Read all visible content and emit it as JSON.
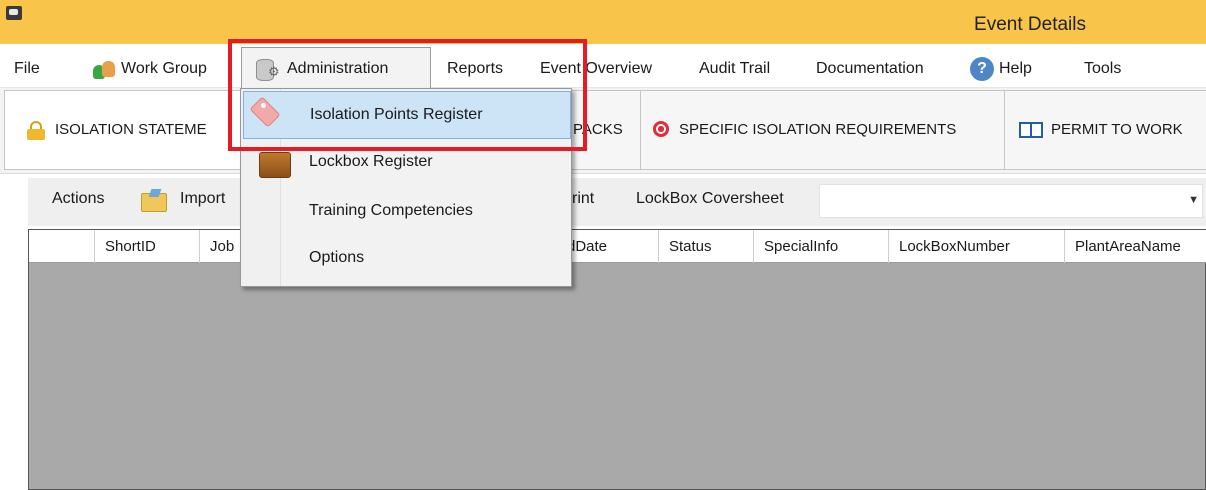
{
  "window": {
    "title": "Event Details"
  },
  "menu": {
    "file": "File",
    "work_group": "Work Group",
    "administration": "Administration",
    "reports": "Reports",
    "event_overview": "Event Overview",
    "audit_trail": "Audit Trail",
    "documentation": "Documentation",
    "help": "Help",
    "tools": "Tools"
  },
  "tabs": {
    "isolation": "ISOLATION STATEME",
    "packs": "PACKS",
    "specific": "SPECIFIC ISOLATION REQUIREMENTS",
    "permit": "PERMIT TO WORK"
  },
  "toolbar": {
    "actions": "Actions",
    "import": "Import",
    "print": "rint",
    "lockbox_coversheet": "LockBox Coversheet",
    "coversheet_value": ""
  },
  "grid": {
    "columns": [
      "ShortID",
      "Job",
      "dDate",
      "Status",
      "SpecialInfo",
      "LockBoxNumber",
      "PlantAreaName"
    ]
  },
  "administration_menu": {
    "items": [
      "Isolation Points Register",
      "Lockbox Register",
      "Training Competencies",
      "Options"
    ],
    "highlighted_item": "Isolation Points Register"
  },
  "colors": {
    "titlebar": "#f8c54a",
    "highlight_border": "#e31c25",
    "selected_item": "#cde4f7",
    "grid_background": "#a9a9a9"
  },
  "icons": {
    "work_group": "people-icon",
    "administration": "database-gear-icon",
    "help": "help-circle-icon",
    "isolation_tab": "padlock-icon",
    "specific_tab": "target-icon",
    "permit_tab": "book-icon",
    "import": "folder-import-icon",
    "isolation_points": "tag-icon",
    "lockbox": "lockbox-icon"
  }
}
